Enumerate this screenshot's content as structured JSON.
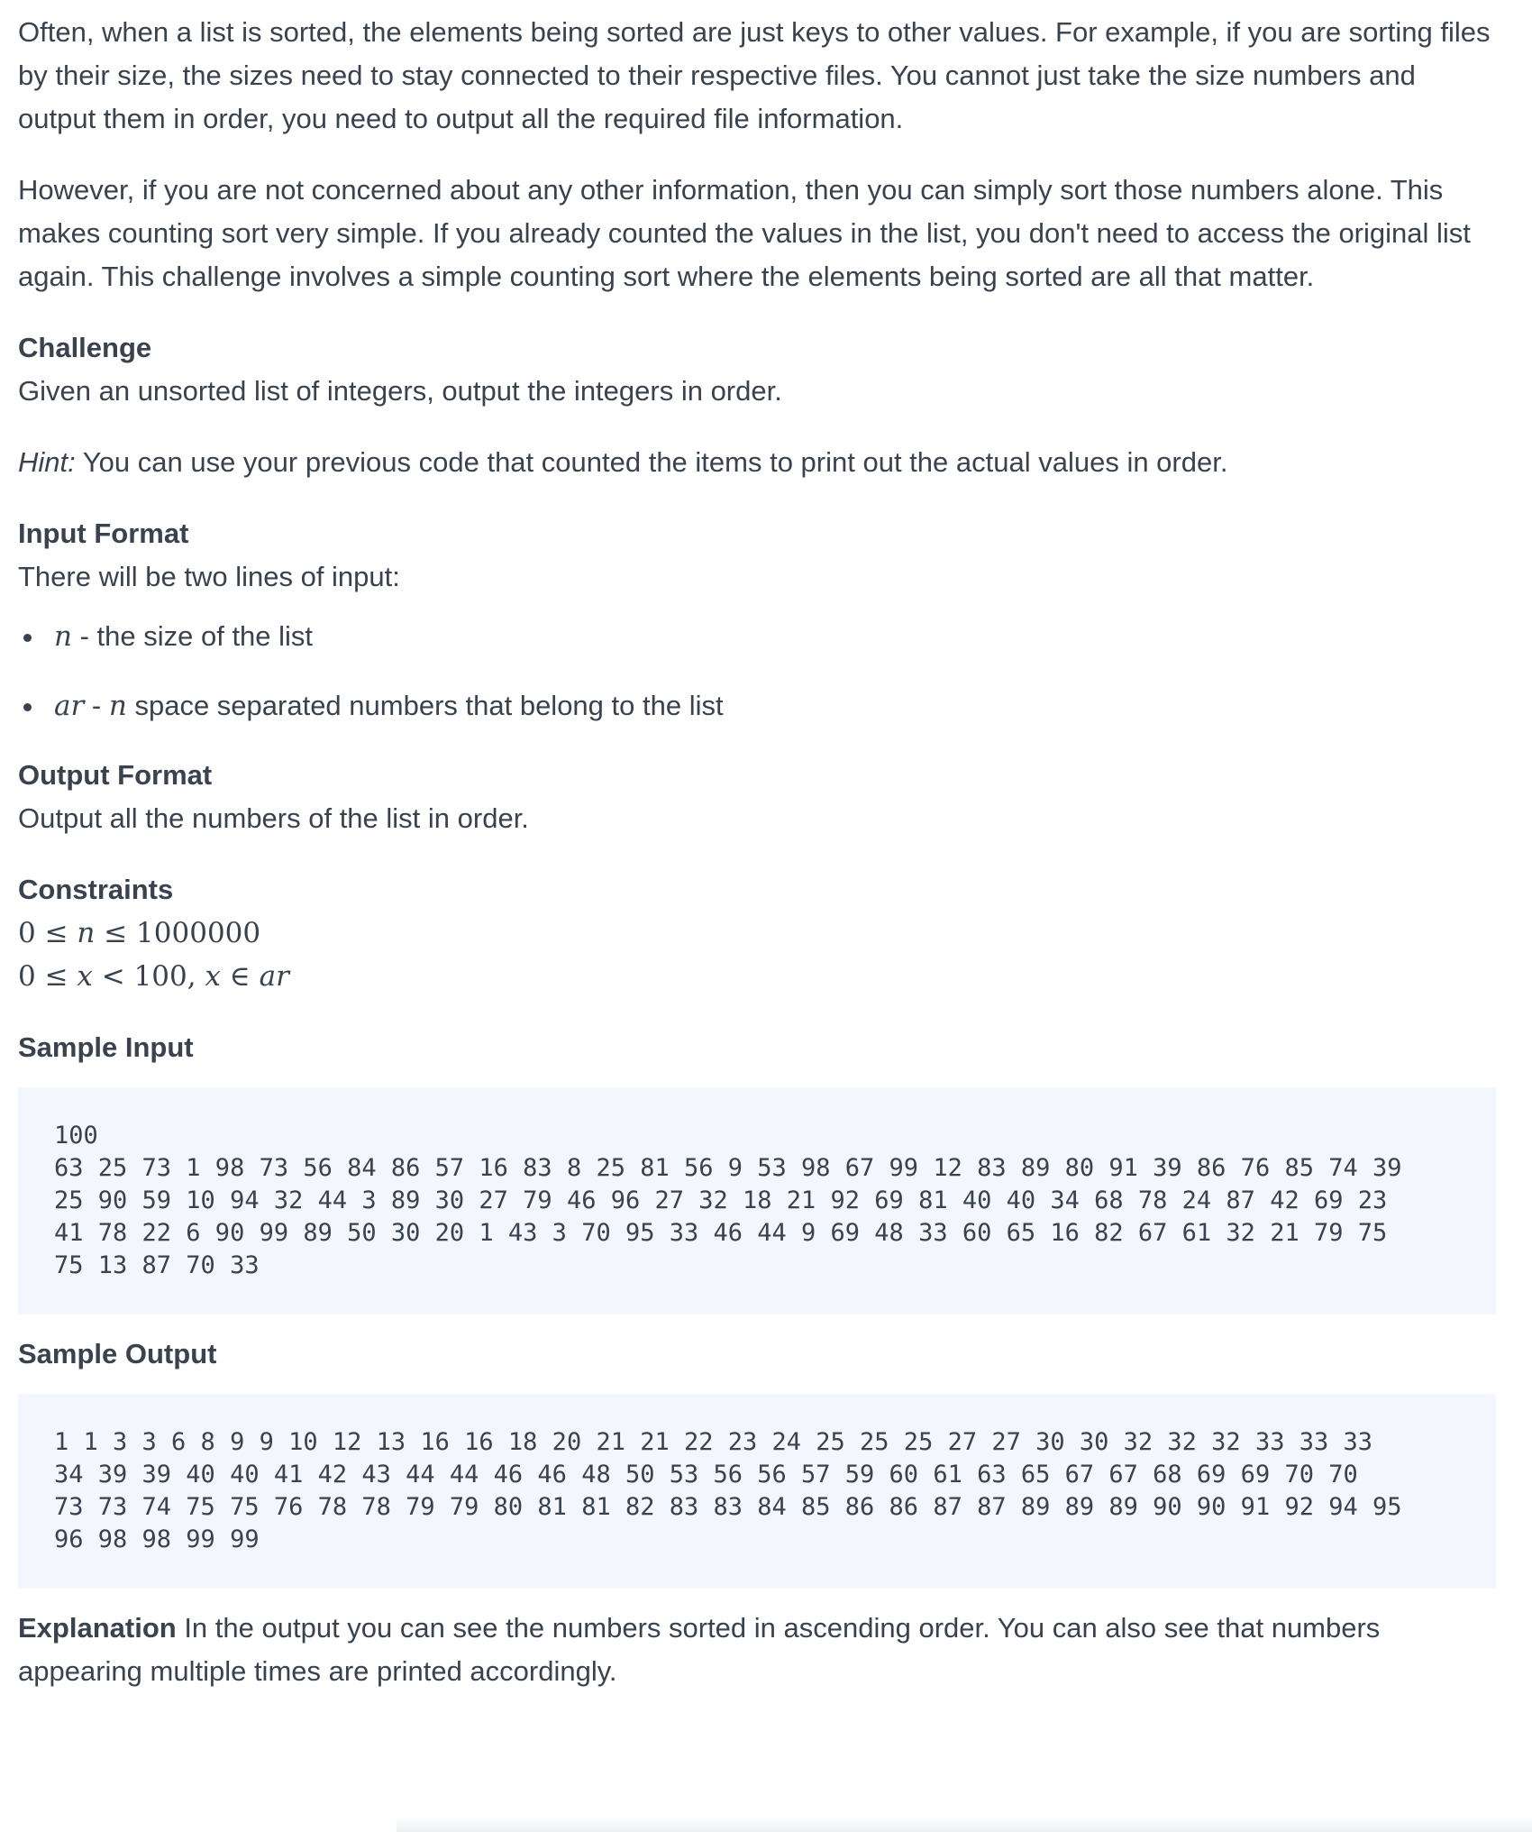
{
  "intro": {
    "p1": "Often, when a list is sorted, the elements being sorted are just keys to other values. For example, if you are sorting files by their size, the sizes need to stay connected to their respective files. You cannot just take the size numbers and output them in order, you need to output all the required file information.",
    "p2": "However, if you are not concerned about any other information, then you can simply sort those numbers alone. This makes counting sort very simple. If you already counted the values in the list, you don't need to access the original list again. This challenge involves a simple counting sort where the elements being sorted are all that matter."
  },
  "challenge": {
    "heading": "Challenge",
    "body": "Given an unsorted list of integers, output the integers in order."
  },
  "hint": {
    "label": "Hint:",
    "body": " You can use your previous code that counted the items to print out the actual values in order."
  },
  "input_format": {
    "heading": "Input Format",
    "body": "There will be two lines of input:",
    "items": [
      {
        "var": "n",
        "sep": " - ",
        "text": "the size of the list"
      },
      {
        "var": "ar",
        "sep": " - ",
        "var2": "n",
        "text": " space separated numbers that belong to the list"
      }
    ]
  },
  "output_format": {
    "heading": "Output Format",
    "body": "Output all the numbers of the list in order."
  },
  "constraints": {
    "heading": "Constraints",
    "line1": {
      "a": "0 ≤ ",
      "v": "n",
      "b": " ≤ 1000000"
    },
    "line2": {
      "a": "0 ≤ ",
      "v1": "x",
      "b": " < 100, ",
      "v2": "x",
      "c": " ∈ ",
      "v3": "ar"
    }
  },
  "sample_input": {
    "heading": "Sample Input",
    "lines": [
      "100",
      "63 25 73 1 98 73 56 84 86 57 16 83 8 25 81 56 9 53 98 67 99 12 83 89 80 91 39 86 76 85 74 39",
      "25 90 59 10 94 32 44 3 89 30 27 79 46 96 27 32 18 21 92 69 81 40 40 34 68 78 24 87 42 69 23",
      "41 78 22 6 90 99 89 50 30 20 1 43 3 70 95 33 46 44 9 69 48 33 60 65 16 82 67 61 32 21 79 75",
      "75 13 87 70 33"
    ]
  },
  "sample_output": {
    "heading": "Sample Output",
    "lines": [
      "1 1 3 3 6 8 9 9 10 12 13 16 16 18 20 21 21 22 23 24 25 25 25 27 27 30 30 32 32 32 33 33 33",
      "34 39 39 40 40 41 42 43 44 44 46 46 48 50 53 56 56 57 59 60 61 63 65 67 67 68 69 69 70 70",
      "73 73 74 75 75 76 78 78 79 79 80 81 81 82 83 83 84 85 86 86 87 87 89 89 89 90 90 91 92 94 95",
      "96 98 98 99 99"
    ]
  },
  "explanation": {
    "label": "Explanation",
    "body": " In the output you can see the numbers sorted in ascending order. You can also see that numbers appearing multiple times are printed accordingly."
  },
  "colors": {
    "text": "#39424e",
    "code_bg": "#f3f7fd"
  }
}
